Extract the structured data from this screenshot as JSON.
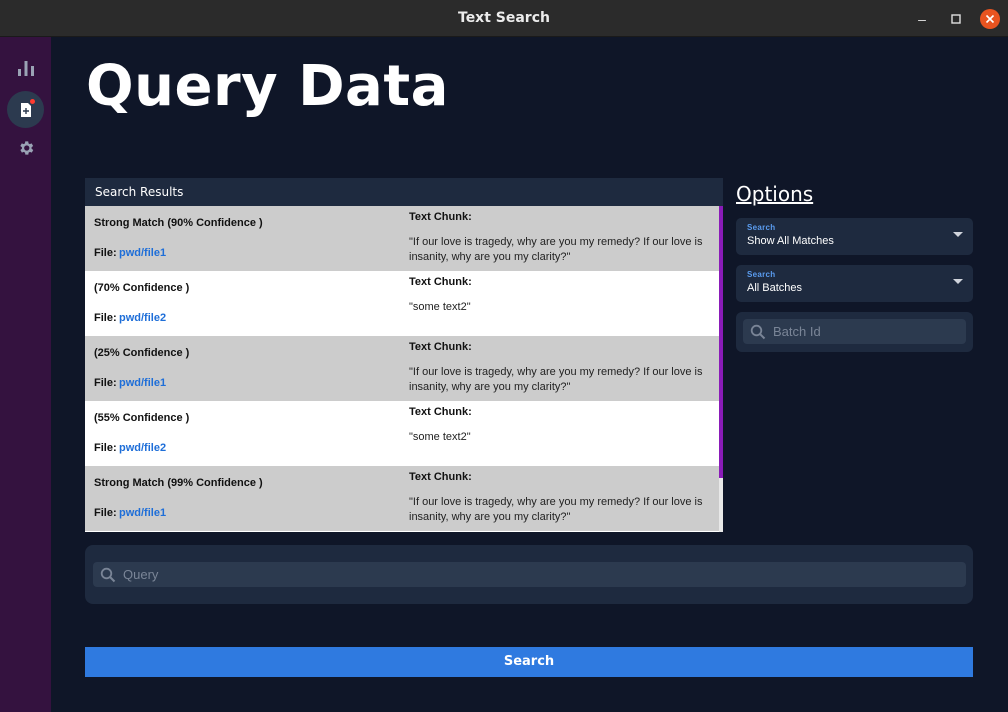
{
  "window": {
    "title": "Text Search"
  },
  "page": {
    "title": "Query Data"
  },
  "sidebar": {
    "items": [
      {
        "icon": "bar-chart-icon"
      },
      {
        "icon": "document-icon",
        "active": true
      },
      {
        "icon": "gear-icon"
      }
    ]
  },
  "results": {
    "header": "Search Results",
    "file_label": "File:",
    "chunk_label": "Text Chunk:",
    "rows": [
      {
        "confidence": "Strong Match (90% Confidence )",
        "file": "pwd/file1",
        "chunk": "\"If our love is tragedy, why are you my remedy? If our love is insanity, why are you my clarity?\""
      },
      {
        "confidence": "(70% Confidence )",
        "file": "pwd/file2",
        "chunk": "\"some text2\""
      },
      {
        "confidence": "(25% Confidence )",
        "file": "pwd/file1",
        "chunk": "\"If our love is tragedy, why are you my remedy? If our love is insanity, why are you my clarity?\""
      },
      {
        "confidence": "(55% Confidence )",
        "file": "pwd/file2",
        "chunk": "\"some text2\""
      },
      {
        "confidence": "Strong Match (99% Confidence )",
        "file": "pwd/file1",
        "chunk": "\"If our love is tragedy, why are you my remedy? If our love is insanity, why are you my clarity?\""
      }
    ]
  },
  "options": {
    "title": "Options",
    "match_select": {
      "label": "Search",
      "value": "Show All Matches"
    },
    "batch_select": {
      "label": "Search",
      "value": "All Batches"
    },
    "batch_id_placeholder": "Batch Id"
  },
  "query": {
    "placeholder": "Query"
  },
  "search_button": "Search"
}
